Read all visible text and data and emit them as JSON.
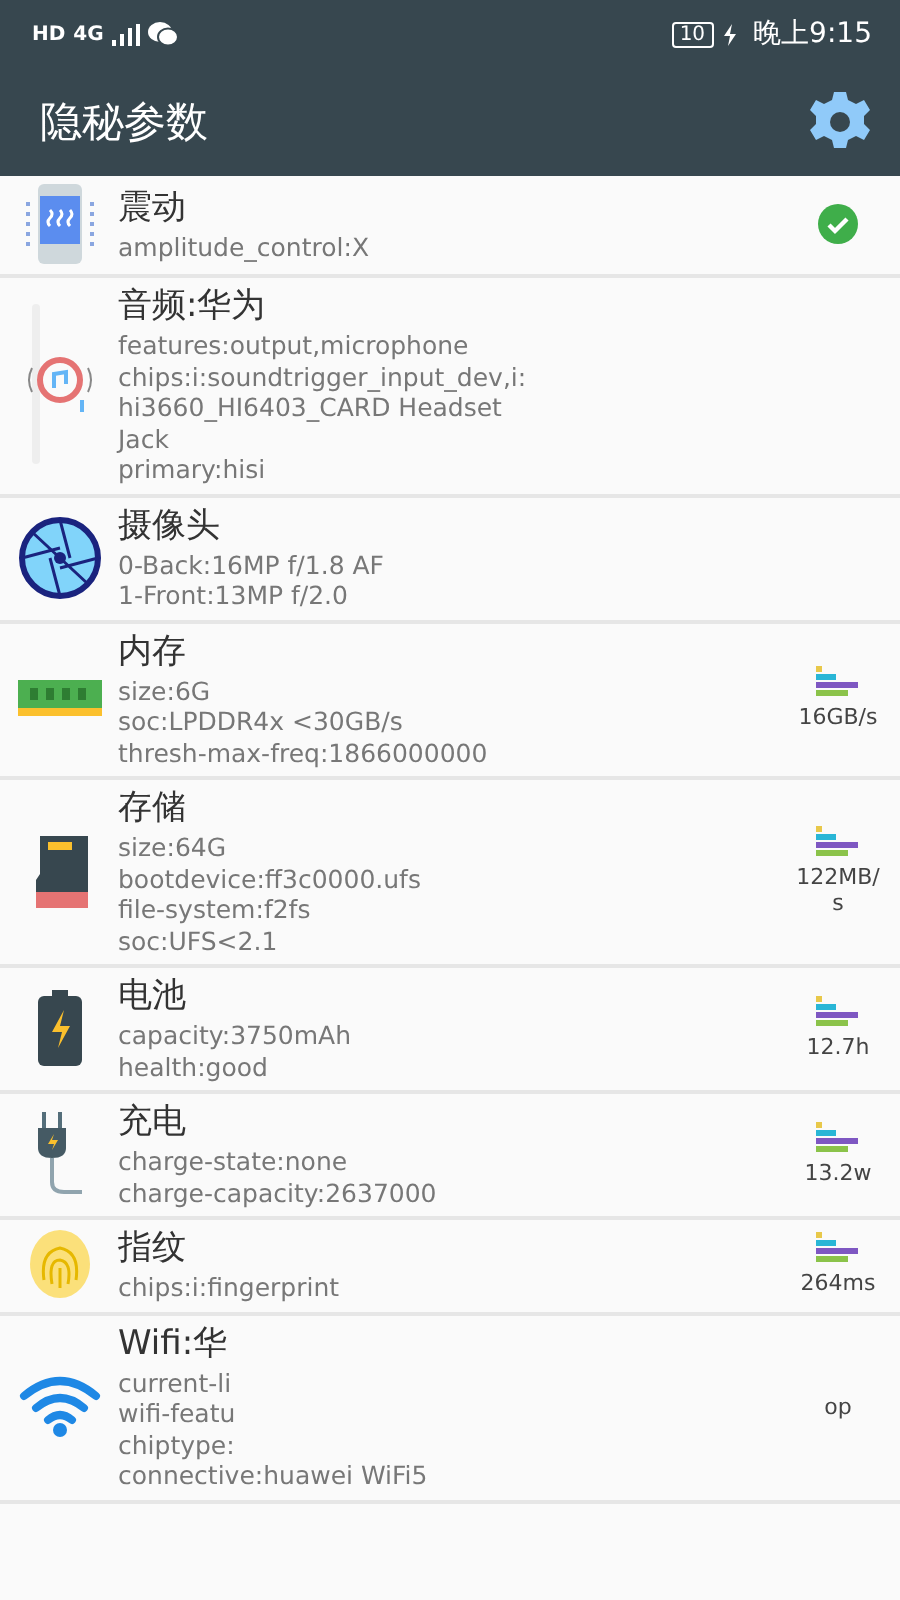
{
  "status_bar": {
    "left": [
      "HD",
      "4G"
    ],
    "battery": "10",
    "time": "晚上9:15"
  },
  "header": {
    "title": "隐秘参数"
  },
  "rows": [
    {
      "title": "震动",
      "details": [
        "amplitude_control:X"
      ],
      "kind": "check"
    },
    {
      "title": "音频:华为",
      "details": [
        "features:output,microphone",
        "chips:i:soundtrigger_input_dev,i:",
        "hi3660_HI6403_CARD Headset",
        "Jack",
        "primary:hisi"
      ],
      "kind": "plain"
    },
    {
      "title": "摄像头",
      "details": [
        "0-Back:16MP f/1.8 AF",
        "1-Front:13MP f/2.0"
      ],
      "kind": "plain"
    },
    {
      "title": "内存",
      "details": [
        "size:6G",
        "soc:LPDDR4x <30GB/s",
        "thresh-max-freq:1866000000"
      ],
      "kind": "meter",
      "reading": "16GB/s"
    },
    {
      "title": "存储",
      "details": [
        "size:64G",
        "bootdevice:ff3c0000.ufs",
        "file-system:f2fs",
        "soc:UFS<2.1"
      ],
      "kind": "meter",
      "reading": "122MB/s"
    },
    {
      "title": "电池",
      "details": [
        "capacity:3750mAh",
        "health:good"
      ],
      "kind": "meter",
      "reading": "12.7h"
    },
    {
      "title": "充电",
      "details": [
        "charge-state:none",
        "charge-capacity:2637000"
      ],
      "kind": "meter",
      "reading": "13.2w"
    },
    {
      "title": "指纹",
      "details": [
        "chips:i:fingerprint"
      ],
      "kind": "meter",
      "reading": "264ms"
    },
    {
      "title": "Wifi:华",
      "details": [
        "current-li",
        "wifi-featu",
        "chiptype:",
        "connective:huawei WiFi5"
      ],
      "kind": "text",
      "reading": "op"
    }
  ]
}
